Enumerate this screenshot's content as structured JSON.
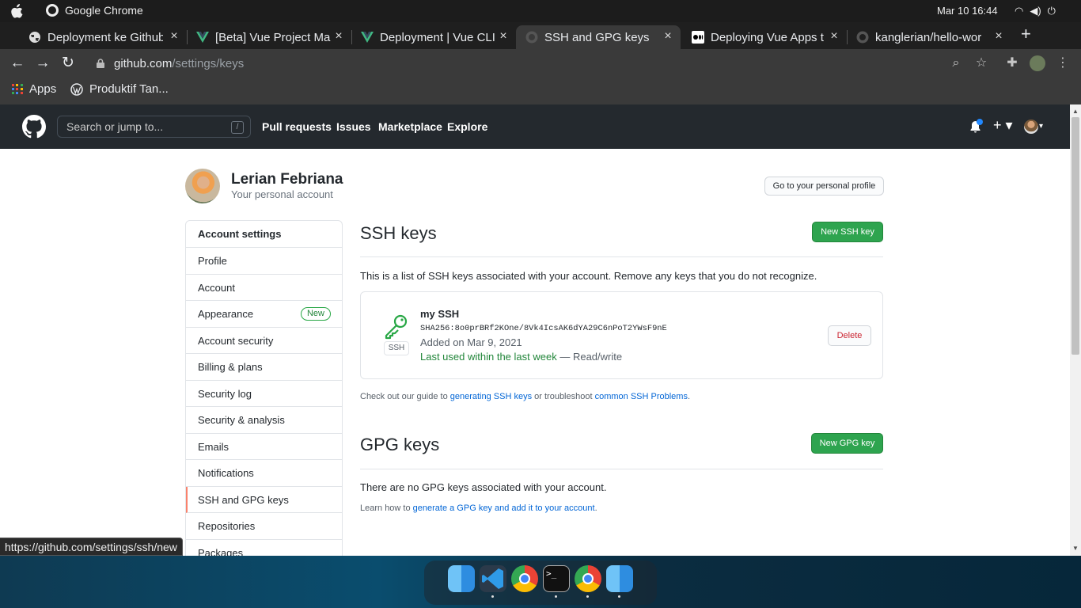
{
  "os": {
    "app_name": "Google Chrome",
    "clock": "Mar 10  16:44"
  },
  "browser": {
    "tabs": [
      {
        "title": "Deployment ke Github",
        "favicon": "globe-icon"
      },
      {
        "title": "[Beta] Vue Project Ma",
        "favicon": "vue-icon"
      },
      {
        "title": "Deployment | Vue CLI",
        "favicon": "vue-icon"
      },
      {
        "title": "SSH and GPG keys",
        "favicon": "github-icon",
        "active": true
      },
      {
        "title": "Deploying Vue Apps t",
        "favicon": "medium-icon"
      },
      {
        "title": "kanglerian/hello-wor",
        "favicon": "github-icon"
      }
    ],
    "close_glyph": "×",
    "new_tab_glyph": "+",
    "url_host": "github.com",
    "url_path": "/settings/keys",
    "bookmarks": [
      {
        "label": "Apps",
        "icon": "apps-grid-icon"
      },
      {
        "label": "Produktif Tan...",
        "icon": "wordpress-icon"
      }
    ]
  },
  "github_header": {
    "search_placeholder": "Search or jump to...",
    "search_shortcut": "/",
    "nav": [
      "Pull requests",
      "Issues",
      "Marketplace",
      "Explore"
    ]
  },
  "profile": {
    "name": "Lerian Febriana",
    "subtitle": "Your personal account",
    "go_profile_button": "Go to your personal profile"
  },
  "sidebar": {
    "heading": "Account settings",
    "items": [
      {
        "label": "Profile"
      },
      {
        "label": "Account"
      },
      {
        "label": "Appearance",
        "badge": "New"
      },
      {
        "label": "Account security"
      },
      {
        "label": "Billing & plans"
      },
      {
        "label": "Security log"
      },
      {
        "label": "Security & analysis"
      },
      {
        "label": "Emails"
      },
      {
        "label": "Notifications"
      },
      {
        "label": "SSH and GPG keys",
        "selected": true
      },
      {
        "label": "Repositories"
      },
      {
        "label": "Packages"
      }
    ]
  },
  "ssh": {
    "title": "SSH keys",
    "new_button": "New SSH key",
    "intro": "This is a list of SSH keys associated with your account. Remove any keys that you do not recognize.",
    "keys": [
      {
        "name": "my SSH",
        "fingerprint": "SHA256:8o0prBRf2KOne/8Vk4IcsAK6dYA29C6nPoT2YWsF9nE",
        "added": "Added on Mar 9, 2021",
        "last_used": "Last used within the last week",
        "permission": "— Read/write",
        "type_label": "SSH",
        "delete_button": "Delete"
      }
    ],
    "help_prefix": "Check out our guide to ",
    "help_link1": "generating SSH keys",
    "help_middle": " or troubleshoot ",
    "help_link2": "common SSH Problems",
    "help_suffix": "."
  },
  "gpg": {
    "title": "GPG keys",
    "new_button": "New GPG key",
    "empty": "There are no GPG keys associated with your account.",
    "help_prefix": "Learn how to ",
    "help_link": "generate a GPG key and add it to your account",
    "help_suffix": "."
  },
  "status_bar_url": "https://github.com/settings/ssh/new",
  "dock": [
    "finder-icon",
    "vscode-icon",
    "chrome-icon",
    "terminal-icon",
    "chrome-icon",
    "finder-icon"
  ],
  "colors": {
    "gh_header": "#24292e",
    "green_button": "#2ea44f",
    "link": "#0366d6",
    "selected_accent": "#f9826c"
  }
}
